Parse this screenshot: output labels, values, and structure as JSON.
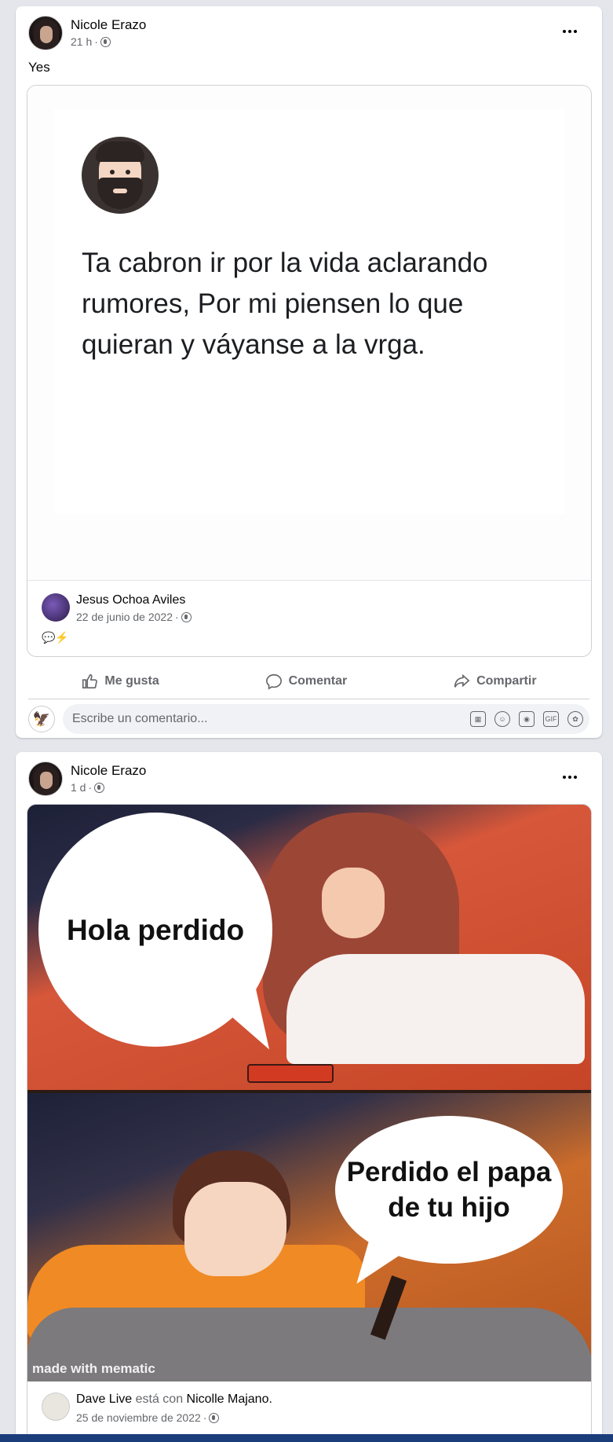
{
  "post1": {
    "author": "Nicole Erazo",
    "time": "21 h",
    "text": "Yes",
    "image_caption": "Ta cabron ir por la vida aclarando rumores, Por mi piensen lo que quieran y váyanse a la vrga.",
    "shared_author": "Jesus Ochoa Aviles",
    "shared_date": "22 de junio de 2022",
    "actions": {
      "like": "Me gusta",
      "comment": "Comentar",
      "share": "Compartir"
    },
    "comment_placeholder": "Escribe un comentario...",
    "comment_tools": [
      "sticker-icon",
      "emoji-icon",
      "camera-icon",
      "gif-icon",
      "avatar-sticker-icon"
    ]
  },
  "post2": {
    "author": "Nicole Erazo",
    "time": "1 d",
    "meme_top_text": "Hola perdido",
    "meme_bottom_text": "Perdido el papa de tu hijo",
    "watermark": "made with mematic",
    "shared_author": "Dave Live",
    "connector": " está con ",
    "tagged": "Nicolle Majano",
    "tag_end": ".",
    "shared_date": "25 de noviembre de 2022"
  },
  "colors": {
    "background": "#e4e6eb",
    "card": "#ffffff",
    "muted": "#65676b",
    "nav_bar": "#1b3d7a"
  }
}
